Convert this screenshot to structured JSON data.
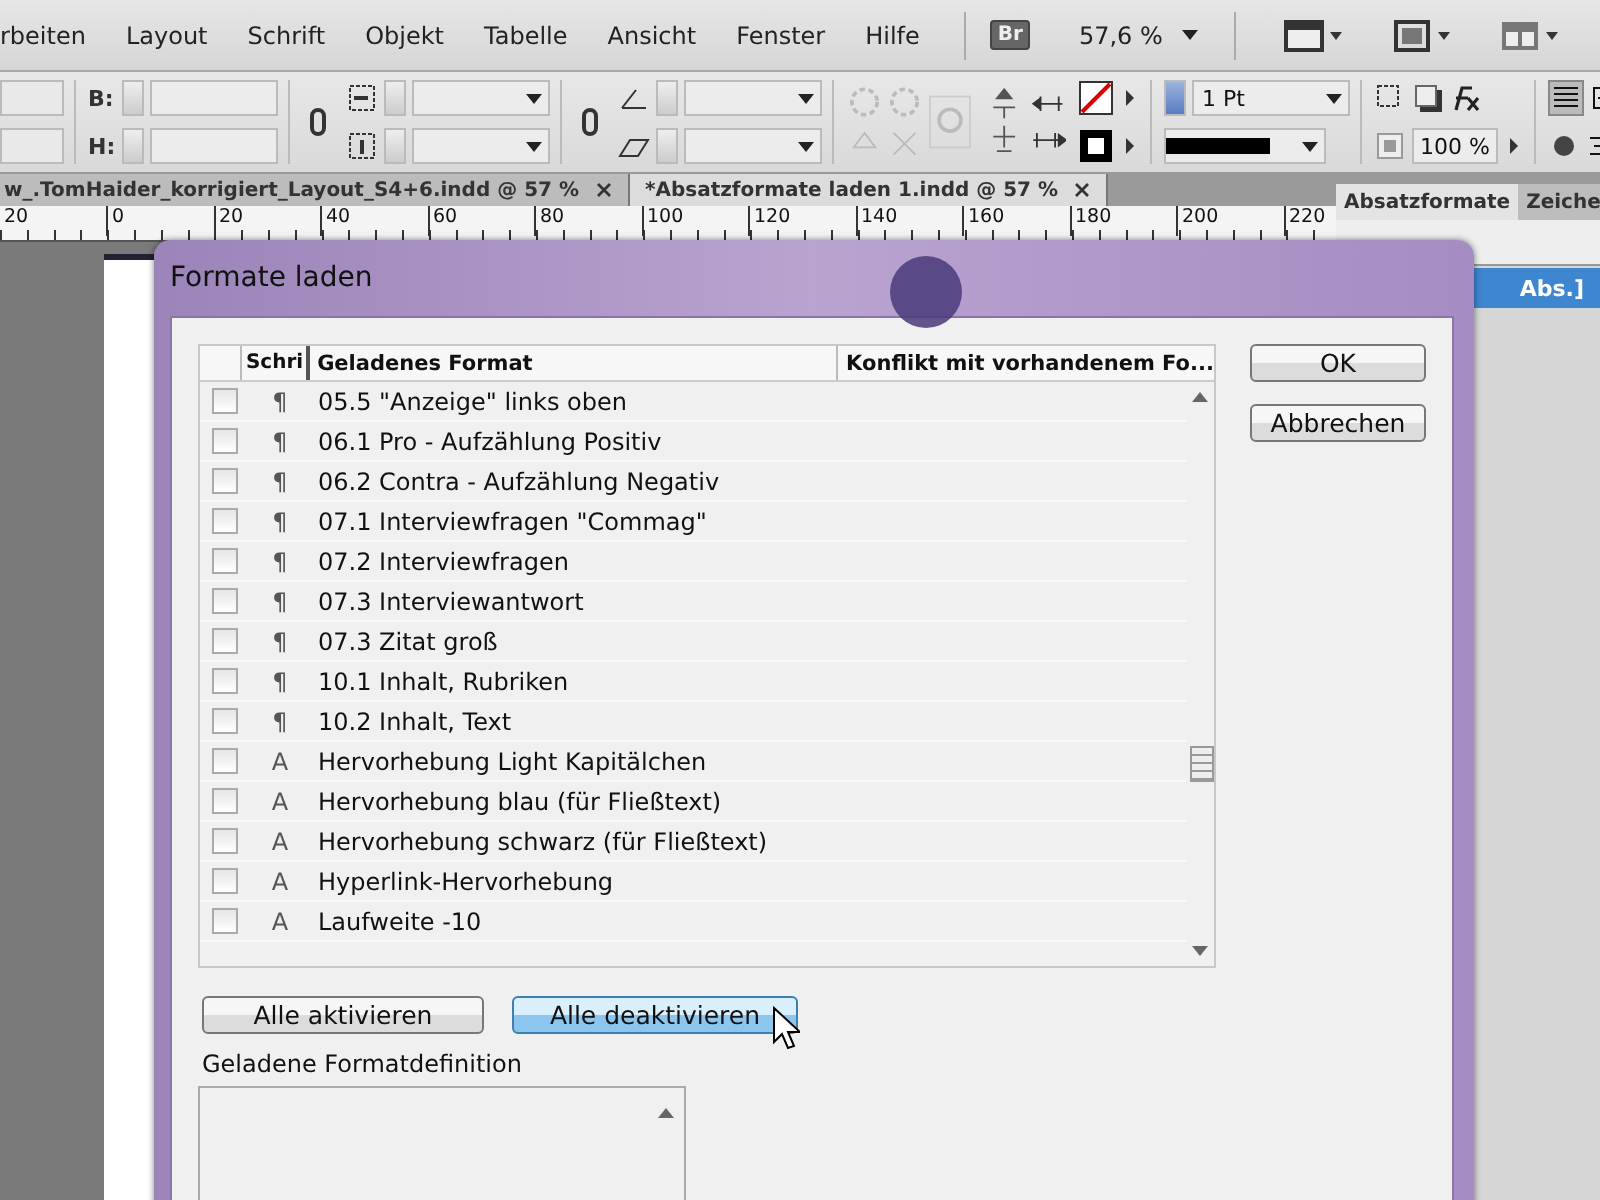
{
  "menu": [
    "rbeiten",
    "Layout",
    "Schrift",
    "Objekt",
    "Tabelle",
    "Ansicht",
    "Fenster",
    "Hilfe"
  ],
  "bridge_button": "Br",
  "zoom": "57,6 %",
  "control_bar": {
    "width_label": "B:",
    "height_label": "H:",
    "stroke_weight": "1 Pt",
    "opacity": "100 %"
  },
  "doc_tabs": [
    {
      "label": "w_.TomHaider_korrigiert_Layout_S4+6.indd @ 57 %",
      "selected": false
    },
    {
      "label": "*Absatzformate laden 1.indd @ 57 %",
      "selected": true
    }
  ],
  "ruler": [
    "20",
    "0",
    "20",
    "40",
    "60",
    "80",
    "100",
    "120",
    "140",
    "160",
    "180",
    "200",
    "220"
  ],
  "panel": {
    "tabs": [
      {
        "label": "Absatzformate",
        "selected": true
      },
      {
        "label": "Zeiche",
        "selected": false
      }
    ],
    "item": "Abs.]"
  },
  "dialog": {
    "title": "Formate laden",
    "columns": [
      "Schri",
      "Geladenes Format",
      "Konflikt mit vorhandenem Fo..."
    ],
    "rows": [
      {
        "checked": false,
        "symbol": "¶",
        "name": "05.5 \"Anzeige\" links oben"
      },
      {
        "checked": false,
        "symbol": "¶",
        "name": "06.1 Pro - Aufzählung Positiv"
      },
      {
        "checked": false,
        "symbol": "¶",
        "name": "06.2 Contra - Aufzählung Negativ"
      },
      {
        "checked": false,
        "symbol": "¶",
        "name": "07.1 Interviewfragen \"Commag\""
      },
      {
        "checked": false,
        "symbol": "¶",
        "name": "07.2 Interviewfragen"
      },
      {
        "checked": false,
        "symbol": "¶",
        "name": "07.3 Interviewantwort"
      },
      {
        "checked": false,
        "symbol": "¶",
        "name": "07.3 Zitat groß"
      },
      {
        "checked": false,
        "symbol": "¶",
        "name": "10.1 Inhalt, Rubriken"
      },
      {
        "checked": false,
        "symbol": "¶",
        "name": "10.2 Inhalt, Text"
      },
      {
        "checked": false,
        "symbol": "A",
        "name": "Hervorhebung Light Kapitälchen"
      },
      {
        "checked": false,
        "symbol": "A",
        "name": "Hervorhebung blau (für Fließtext)"
      },
      {
        "checked": false,
        "symbol": "A",
        "name": "Hervorhebung schwarz (für Fließtext)"
      },
      {
        "checked": false,
        "symbol": "A",
        "name": "Hyperlink-Hervorhebung"
      },
      {
        "checked": false,
        "symbol": "A",
        "name": "Laufweite -10"
      }
    ],
    "ok": "OK",
    "cancel": "Abbrechen",
    "bulk_buttons": [
      {
        "label": "Alle aktivieren",
        "hovered": false
      },
      {
        "label": "Alle deaktivieren",
        "hovered": true
      }
    ],
    "definition_label": "Geladene Formatdefinition"
  }
}
